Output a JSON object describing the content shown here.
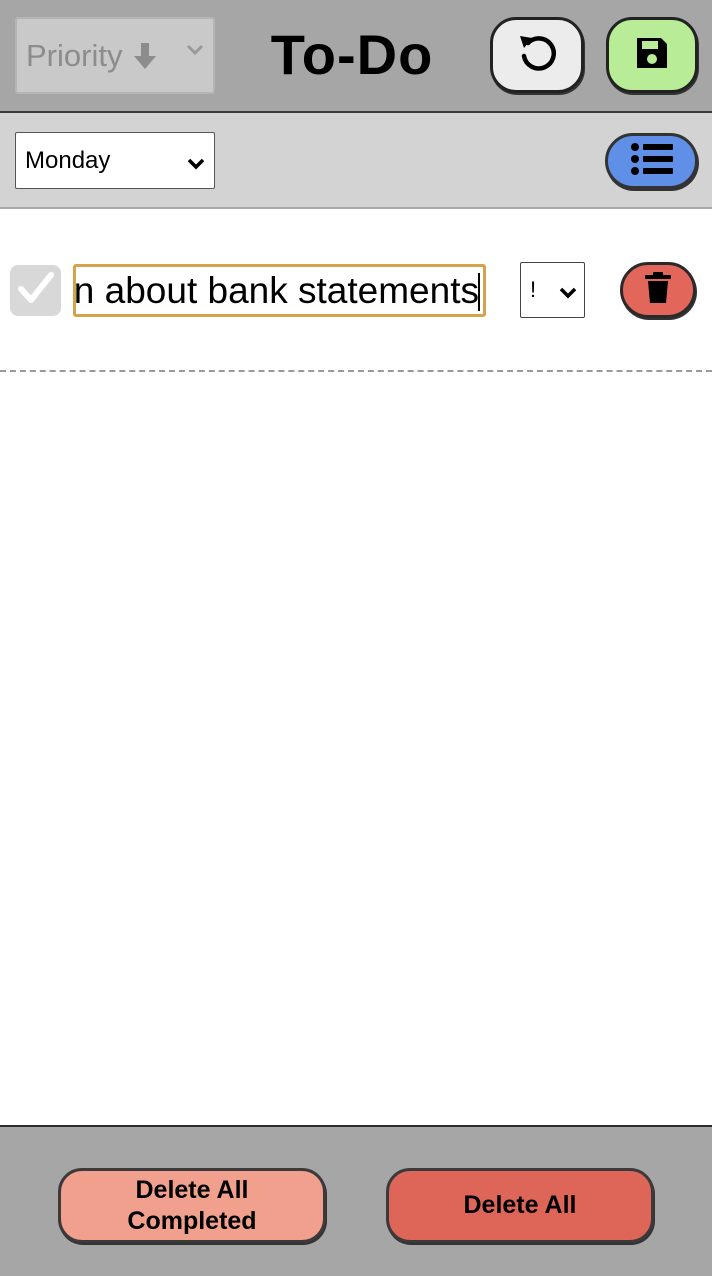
{
  "header": {
    "sort": {
      "label": "Priority",
      "icon": "arrow-down-icon"
    },
    "title": "To-Do",
    "undo_icon": "undo-icon",
    "save_icon": "save-icon"
  },
  "toolbar": {
    "day_select": {
      "value": "Monday"
    },
    "list_icon": "list-icon"
  },
  "tasks": [
    {
      "completed": true,
      "text": "n about bank statements",
      "priority": "!"
    }
  ],
  "footer": {
    "delete_completed_label_line1": "Delete All",
    "delete_completed_label_line2": "Completed",
    "delete_all_label": "Delete All"
  },
  "colors": {
    "header_bg": "#a6a6a6",
    "save_button": "#b9ec96",
    "list_button": "#5f8fe6",
    "delete_button": "#e2665a",
    "delete_completed_button": "#f0a08c",
    "focus_border": "#d6a24a"
  }
}
